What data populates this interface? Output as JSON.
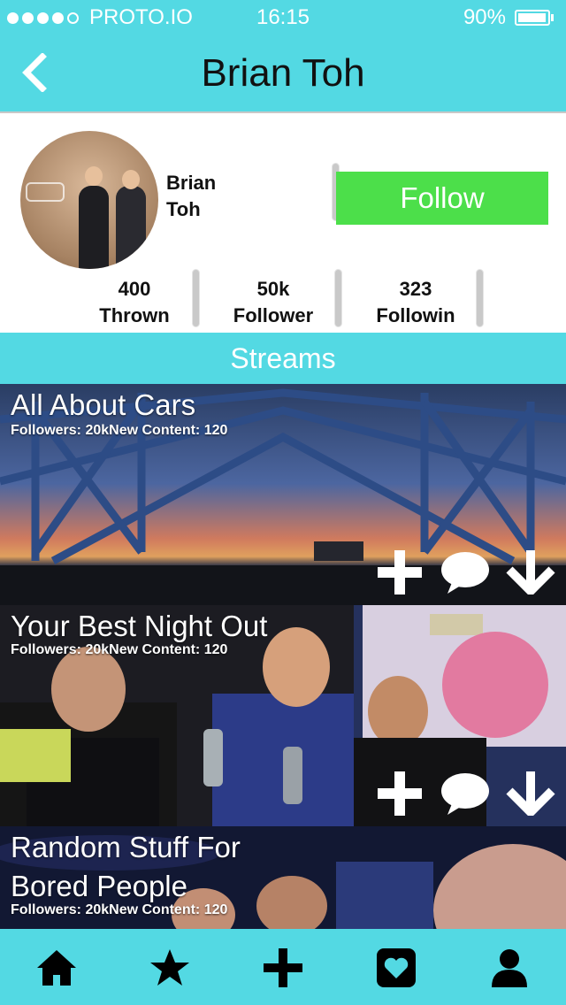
{
  "status_bar": {
    "carrier": "PROTO.IO",
    "time": "16:15",
    "battery": "90%"
  },
  "header": {
    "title": "Brian Toh"
  },
  "profile": {
    "name": "Brian Toh",
    "follow_label": "Follow"
  },
  "stats": [
    {
      "count": "400",
      "label": "Thrown"
    },
    {
      "count": "50k",
      "label": "Follower"
    },
    {
      "count": "323",
      "label": "Followin"
    }
  ],
  "streams_heading": "Streams",
  "streams": [
    {
      "title": "All About Cars",
      "followers": "Followers: 20k",
      "new_content": "New Content: 120"
    },
    {
      "title": "Your Best Night Out",
      "followers": "Followers: 20k",
      "new_content": "New Content: 120"
    },
    {
      "title_line1": "Random Stuff For",
      "title_line2": "Bored People",
      "followers": "Followers: 20k",
      "new_content": "New Content: 120"
    }
  ],
  "tab_bar": {
    "icons": [
      "home-icon",
      "star-icon",
      "plus-icon",
      "heart-box-icon",
      "person-icon"
    ]
  },
  "colors": {
    "accent": "#53d9e3",
    "follow": "#4cdf4a"
  }
}
